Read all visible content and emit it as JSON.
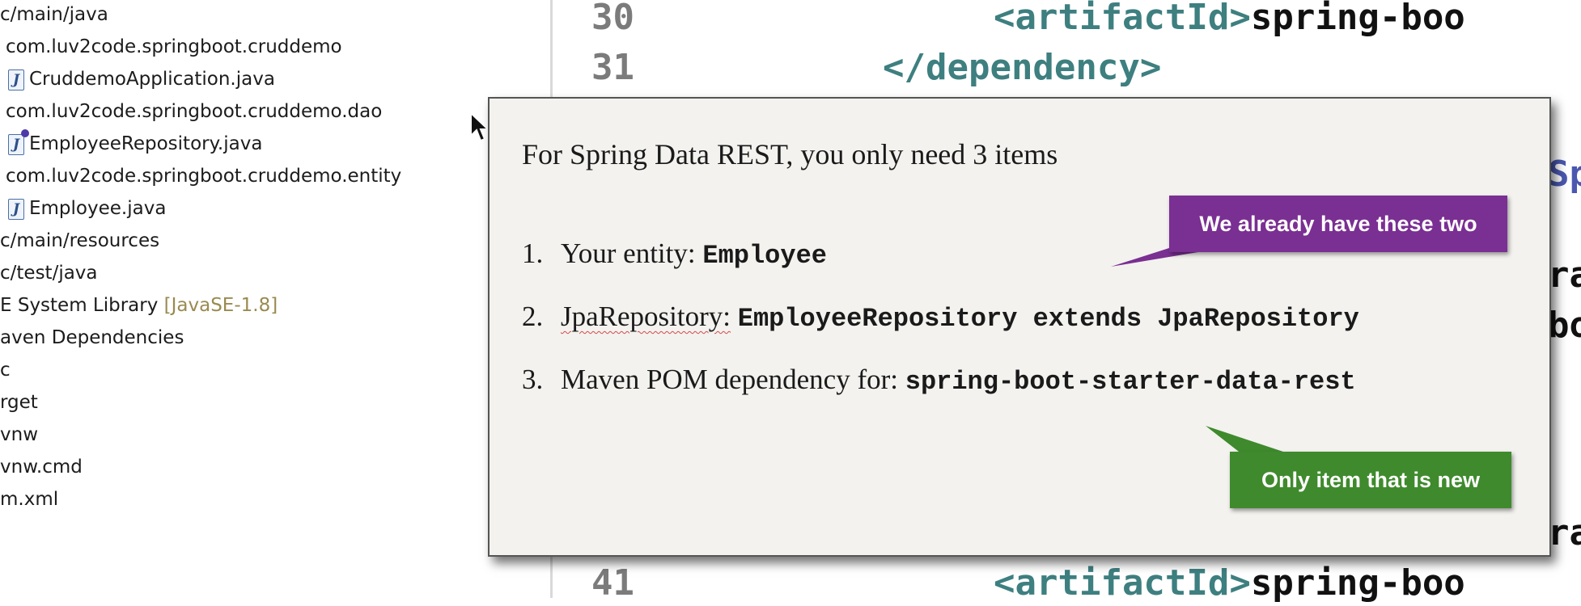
{
  "explorer": {
    "rows": [
      {
        "text": "c/main/java"
      },
      {
        "text": "com.luv2code.springboot.cruddemo"
      },
      {
        "text": "CruddemoApplication.java"
      },
      {
        "text": "com.luv2code.springboot.cruddemo.dao"
      },
      {
        "text": "EmployeeRepository.java"
      },
      {
        "text": "com.luv2code.springboot.cruddemo.entity"
      },
      {
        "text": "Employee.java"
      },
      {
        "text": "c/main/resources"
      },
      {
        "text": "c/test/java"
      },
      {
        "text": "E System Library "
      },
      {
        "text": "aven Dependencies"
      },
      {
        "text": "c"
      },
      {
        "text": "rget"
      },
      {
        "text": "vnw"
      },
      {
        "text": "vnw.cmd"
      },
      {
        "text": "m.xml"
      }
    ],
    "library_suffix": "[JavaSE-1.8]",
    "java_file_icon_letter": "J"
  },
  "editor": {
    "lines": [
      {
        "number": "30",
        "open_tag": "<artifactId>",
        "text": "spring-boo"
      },
      {
        "number": "31",
        "open_tag": "</dependency>",
        "text": ""
      },
      {
        "number": "41",
        "open_tag": "<artifactId>",
        "text": "spring-boo"
      }
    ],
    "edge_fragments": [
      "Sp",
      "ra",
      "bo",
      "ra"
    ]
  },
  "slide": {
    "title": "For Spring Data REST, you only need 3 items",
    "items": [
      {
        "num": "1.",
        "label": "Your entity: ",
        "code": "Employee"
      },
      {
        "num": "2.",
        "label": "JpaRepository:",
        "code": "EmployeeRepository extends JpaRepository"
      },
      {
        "num": "3.",
        "label": "Maven POM dependency for: ",
        "code": "spring-boot-starter-data-rest"
      }
    ],
    "callout_existing": "We already have these two",
    "callout_new": "Only item that is new",
    "colors": {
      "purple": "#7a2f92",
      "green": "#3f8a2d"
    }
  }
}
